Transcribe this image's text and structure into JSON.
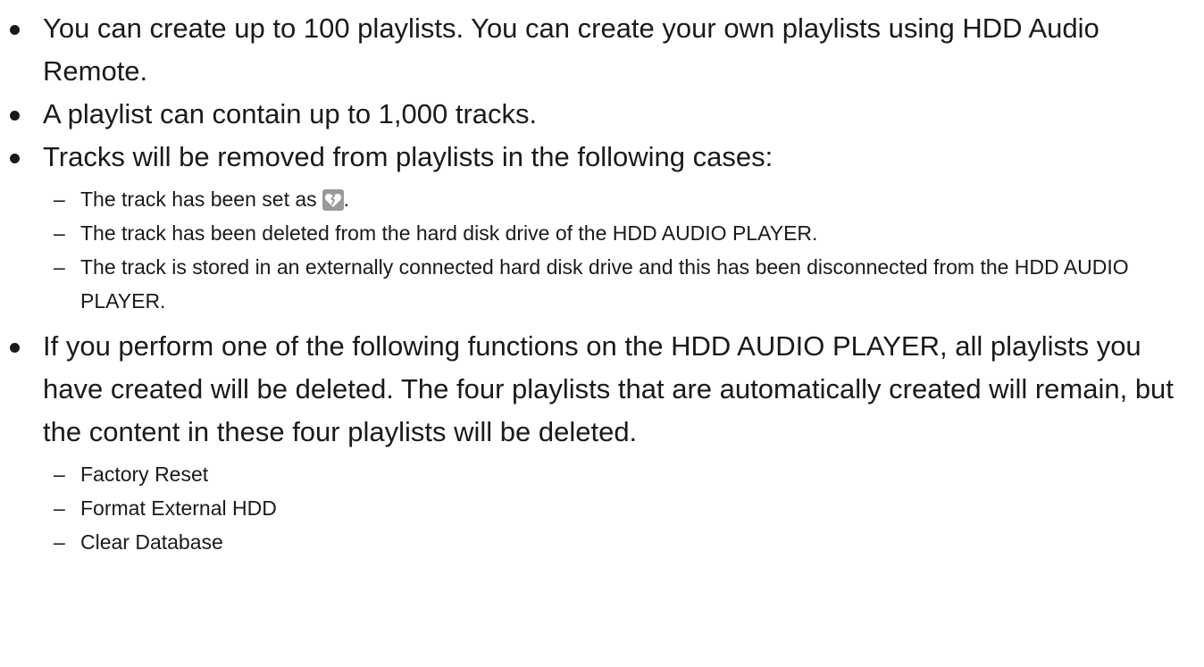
{
  "items": [
    {
      "text": "You can create up to 100 playlists. You can create your own playlists using HDD Audio Remote."
    },
    {
      "text": "A playlist can contain up to 1,000 tracks."
    },
    {
      "text": "Tracks will be removed from playlists in the following cases:",
      "sub": [
        {
          "text": "The track has been set as",
          "suffix": ".",
          "icon": "broken-heart-icon"
        },
        {
          "text": "The track has been deleted from the hard disk drive of the HDD AUDIO PLAYER."
        },
        {
          "text": "The track is stored in an externally connected hard disk drive and this has been disconnected from the HDD AUDIO PLAYER."
        }
      ]
    },
    {
      "text": "If you perform one of the following functions on the HDD AUDIO PLAYER, all playlists you have created will be deleted. The four playlists that are automatically created will remain, but the content in these four playlists will be deleted.",
      "sub": [
        {
          "text": "Factory Reset"
        },
        {
          "text": "Format External HDD"
        },
        {
          "text": "Clear Database"
        }
      ]
    }
  ],
  "dash": "–",
  "colors": {
    "text": "#1a1a1a",
    "icon_bg": "#9a9a9a",
    "icon_fg": "#ffffff"
  }
}
